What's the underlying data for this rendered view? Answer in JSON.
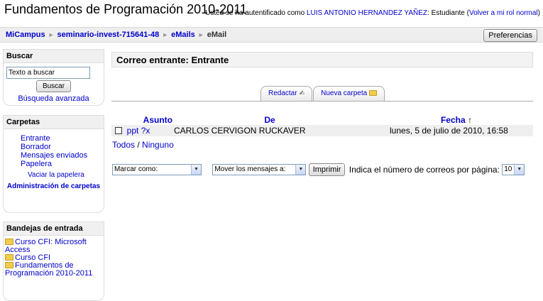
{
  "header": {
    "title": "Fundamentos de Programación 2010-2011",
    "login_prefix": "Usted se ha autentificado como ",
    "user_name": "LUIS ANTONIO HERNANDEZ YAÑEZ",
    "role_text": ": Estudiante (",
    "return_role": "Volver a mi rol normal",
    "close_paren": ")"
  },
  "breadcrumb": {
    "items": [
      "MiCampus",
      "seminario-invest-715641-48",
      "eMails",
      "eMail"
    ],
    "separator": "►"
  },
  "toolbar": {
    "preferences_label": "Preferencias"
  },
  "search_block": {
    "title": "Buscar",
    "input_value": "Texto a buscar",
    "button_label": "Buscar",
    "advanced_link": "Búsqueda avanzada"
  },
  "folders_block": {
    "title": "Carpetas",
    "items": [
      "Entrante",
      "Borrador",
      "Mensajes enviados",
      "Papelera"
    ],
    "empty_trash": "Vaciar la papelera",
    "admin": "Administración de carpetas"
  },
  "inbox_block": {
    "title": "Bandejas de entrada",
    "items": [
      "Curso CFI: Microsoft Access",
      "Curso CFI",
      "Fundamentos de Programación 2010-2011"
    ]
  },
  "main": {
    "title": "Correo entrante: Entrante",
    "tabs": [
      "Redactar",
      "Nueva carpeta"
    ],
    "columns": {
      "subject": "Asunto",
      "from": "De",
      "date": "Fecha",
      "sort_arrow": "↑"
    },
    "rows": [
      {
        "subject": "ppt ?x",
        "from": "CARLOS CERVIGON RUCKAVER",
        "date": "lunes, 5 de julio de 2010, 16:58"
      }
    ],
    "select_all": "Todos",
    "select_sep": " / ",
    "select_none": "Ninguno",
    "mark_as": "Marcar como:",
    "move_to": "Mover los mensajes a:",
    "print_label": "Imprimir",
    "per_page_label": "Indica el número de correos por página:",
    "per_page_value": "10"
  },
  "colors": {
    "link": "#0000cc",
    "block_header_bg": "#f0f0f0",
    "row_bg": "#efefef"
  }
}
